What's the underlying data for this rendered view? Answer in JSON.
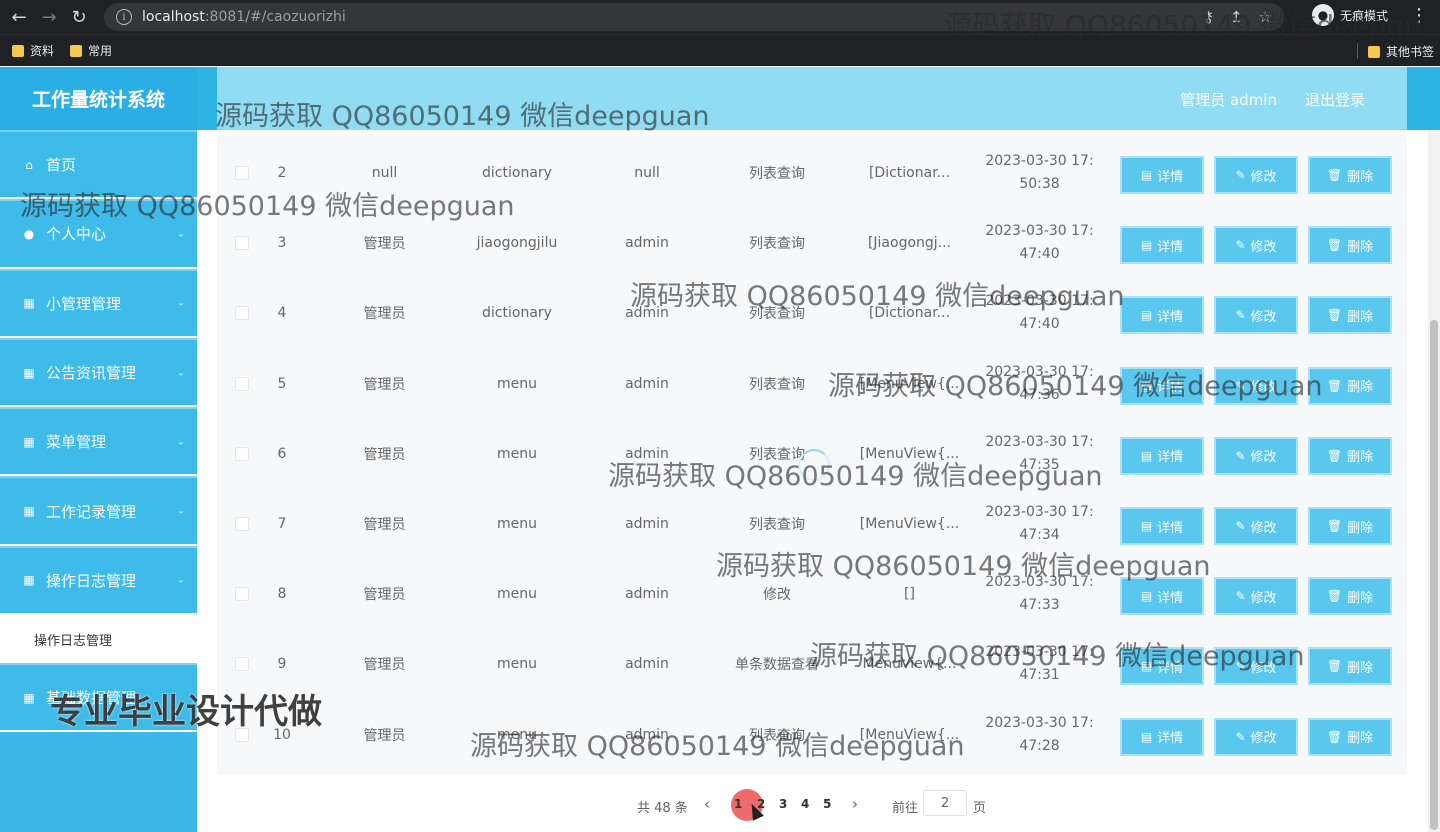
{
  "browser": {
    "url_host": "localhost",
    "url_path": ":8081/#/caozuorizhi",
    "incognito_label": "无痕模式",
    "bookmarks": [
      "资料",
      "常用"
    ],
    "other_bookmarks": "其他书签"
  },
  "app": {
    "title": "工作量统计系统",
    "user_label": "管理员 admin",
    "logout": "退出登录"
  },
  "sidebar": {
    "items": [
      {
        "label": "首页",
        "icon": "home-icon"
      },
      {
        "label": "个人中心",
        "icon": "user-icon"
      },
      {
        "label": "小管理管理",
        "icon": "grid-icon"
      },
      {
        "label": "公告资讯管理",
        "icon": "grid-icon"
      },
      {
        "label": "菜单管理",
        "icon": "grid-icon"
      },
      {
        "label": "工作记录管理",
        "icon": "grid-icon"
      },
      {
        "label": "操作日志管理",
        "icon": "grid-icon"
      }
    ],
    "active_sub": "操作日志管理",
    "last_item": "基础数据管理"
  },
  "table": {
    "rows": [
      {
        "idx": "2",
        "role": "null",
        "table": "dictionary",
        "user": "null",
        "op": "列表查询",
        "detail": "[Dictionar...",
        "date": "2023-03-30 17:",
        "time": "50:38"
      },
      {
        "idx": "3",
        "role": "管理员",
        "table": "jiaogongjilu",
        "user": "admin",
        "op": "列表查询",
        "detail": "[Jiaogongj...",
        "date": "2023-03-30 17:",
        "time": "47:40"
      },
      {
        "idx": "4",
        "role": "管理员",
        "table": "dictionary",
        "user": "admin",
        "op": "列表查询",
        "detail": "[Dictionar...",
        "date": "2023-03-30 17:",
        "time": "47:40"
      },
      {
        "idx": "5",
        "role": "管理员",
        "table": "menu",
        "user": "admin",
        "op": "列表查询",
        "detail": "[MenuView{...",
        "date": "2023-03-30 17:",
        "time": "47:36"
      },
      {
        "idx": "6",
        "role": "管理员",
        "table": "menu",
        "user": "admin",
        "op": "列表查询",
        "detail": "[MenuView{...",
        "date": "2023-03-30 17:",
        "time": "47:35"
      },
      {
        "idx": "7",
        "role": "管理员",
        "table": "menu",
        "user": "admin",
        "op": "列表查询",
        "detail": "[MenuView{...",
        "date": "2023-03-30 17:",
        "time": "47:34"
      },
      {
        "idx": "8",
        "role": "管理员",
        "table": "menu",
        "user": "admin",
        "op": "修改",
        "detail": "[]",
        "date": "2023-03-30 17:",
        "time": "47:33"
      },
      {
        "idx": "9",
        "role": "管理员",
        "table": "menu",
        "user": "admin",
        "op": "单条数据查看",
        "detail": "MenuView{...",
        "date": "2023-03-30 17:",
        "time": "47:31"
      },
      {
        "idx": "10",
        "role": "管理员",
        "table": "menu",
        "user": "admin",
        "op": "列表查询",
        "detail": "[MenuView{...",
        "date": "2023-03-30 17:",
        "time": "47:28"
      }
    ],
    "actions": {
      "detail": "详情",
      "edit": "修改",
      "delete": "删除"
    }
  },
  "pagination": {
    "total": "共 48 条",
    "pages": [
      "1",
      "2",
      "3",
      "4",
      "5"
    ],
    "current": "1",
    "goto_label": "前往",
    "goto_value": "2",
    "unit": "页"
  },
  "watermarks": {
    "text": "源码获取 QQ86050149 微信deepguan",
    "top_right": "源码获取 QQ86050149 微信deepgu",
    "big": "专业毕业设计代做"
  },
  "colors": {
    "primary": "#3bb8e8",
    "button": "#59c7ee",
    "active_page": "#ee6b6b"
  }
}
